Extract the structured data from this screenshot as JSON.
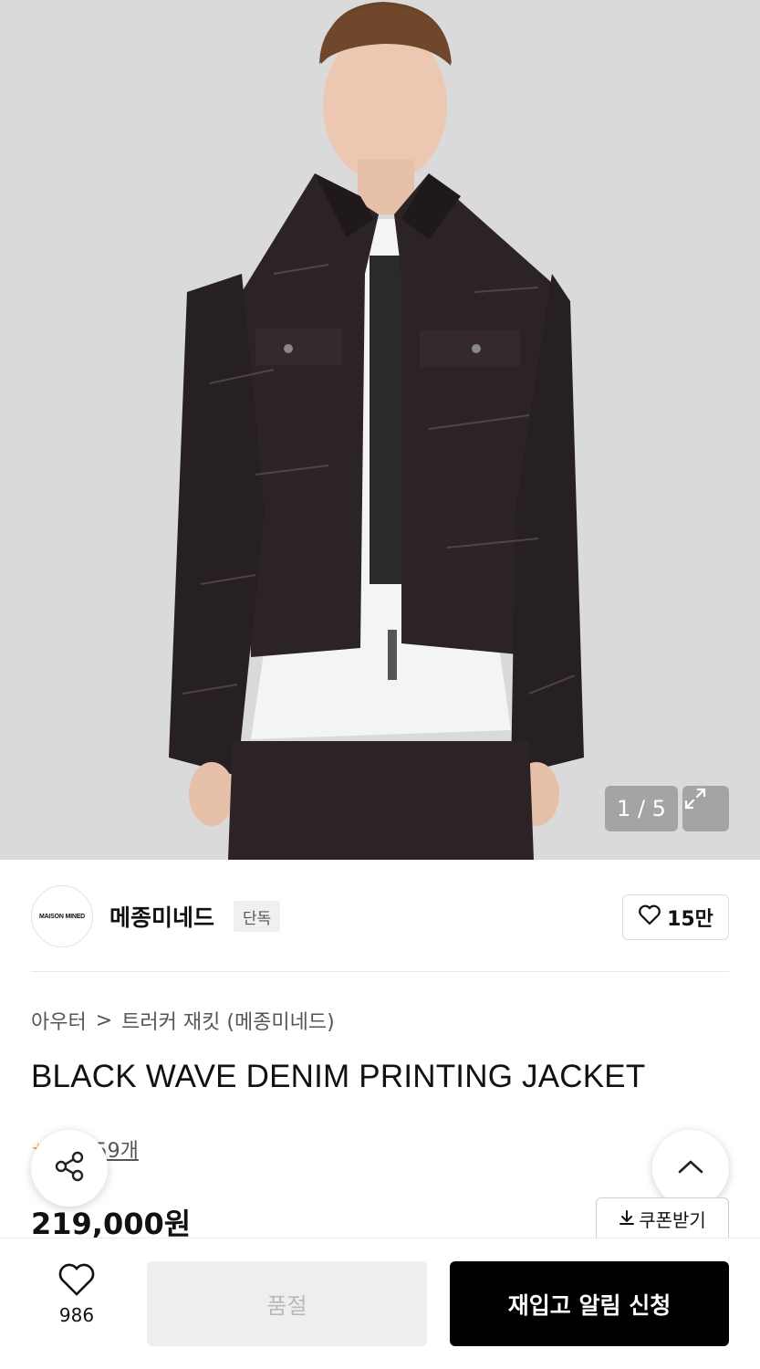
{
  "gallery": {
    "counter": "1 / 5",
    "expand_icon": "expand-icon"
  },
  "brand": {
    "logo_text": "MAISON MINED",
    "name": "메종미네드",
    "tag": "단독",
    "likes": "15만",
    "like_icon": "heart-icon"
  },
  "breadcrumb": {
    "items": [
      "아우터",
      "트러커 재킷 (메종미네드)"
    ],
    "separator": ">"
  },
  "product": {
    "title": "BLACK WAVE DENIM PRINTING JACKET",
    "review_label": "후기 59개",
    "price": "219,000원"
  },
  "actions": {
    "coupon_label": "쿠폰받기",
    "share_icon": "share-icon",
    "top_icon": "chevron-up-icon"
  },
  "bottom_bar": {
    "wish_count": "986",
    "soldout_label": "품절",
    "restock_label": "재입고 알림 신청"
  },
  "colors": {
    "accent": "#000000",
    "star": "#f5a623",
    "soldout_bg": "#eeeeee",
    "soldout_text": "#b9b9b9"
  }
}
